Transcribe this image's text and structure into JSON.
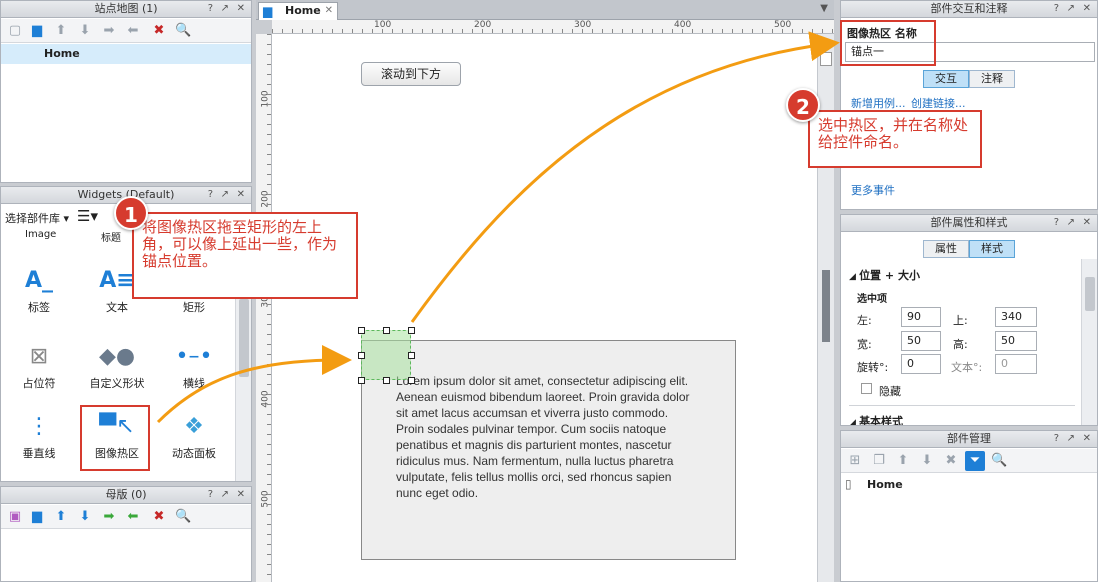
{
  "sitemap": {
    "title": "站点地图 (1)",
    "controls": [
      "?",
      "↗",
      "✕"
    ],
    "pages": [
      "Home"
    ]
  },
  "widgets": {
    "title": "Widgets (Default)",
    "library_label": "选择部件库 ▾",
    "partial_top": [
      "Image",
      "标题"
    ],
    "items": [
      {
        "label": "标签",
        "icon": "label-icon"
      },
      {
        "label": "文本",
        "icon": "text-icon"
      },
      {
        "label": "矩形",
        "icon": "rectangle-icon"
      },
      {
        "label": "占位符",
        "icon": "placeholder-icon"
      },
      {
        "label": "自定义形状",
        "icon": "custom-shape-icon"
      },
      {
        "label": "横线",
        "icon": "horizontal-line-icon"
      },
      {
        "label": "垂直线",
        "icon": "vertical-line-icon"
      },
      {
        "label": "图像热区",
        "icon": "image-hotspot-icon"
      },
      {
        "label": "动态面板",
        "icon": "dynamic-panel-icon"
      }
    ]
  },
  "masters": {
    "title": "母版 (0)"
  },
  "canvas": {
    "tab_label": "Home",
    "ruler_h": [
      "100",
      "200",
      "300",
      "400",
      "500"
    ],
    "ruler_v": [
      "100",
      "200",
      "300",
      "400",
      "500"
    ],
    "button_label": "滚动到下方",
    "lorem": "Lorem ipsum dolor sit amet, consectetur adipiscing elit. Aenean euismod bibendum laoreet. Proin gravida dolor sit amet lacus accumsan et viverra justo commodo. Proin sodales pulvinar tempor. Cum sociis natoque penatibus et magnis dis parturient montes, nascetur ridiculus mus. Nam fermentum, nulla luctus pharetra vulputate, felis tellus mollis orci, sed rhoncus sapien nunc eget odio."
  },
  "interaction": {
    "title": "部件交互和注释",
    "name_label": "图像热区 名称",
    "name_value": "锚点一",
    "tab_interact": "交互",
    "tab_notes": "注释",
    "link_new_case": "新增用例...",
    "link_create_link": "创建链接...",
    "more_events": "更多事件"
  },
  "props": {
    "title": "部件属性和样式",
    "tab_props": "属性",
    "tab_style": "样式",
    "section_pos": "位置 + 大小",
    "selected_label": "选中项",
    "left_label": "左:",
    "left_value": "90",
    "top_label": "上:",
    "top_value": "340",
    "width_label": "宽:",
    "width_value": "50",
    "height_label": "高:",
    "height_value": "50",
    "rotate_label": "旋转°:",
    "rotate_value": "0",
    "text_rot_label": "文本°:",
    "text_rot_value": "0",
    "hide_label": "隐藏",
    "section_basic": "基本样式"
  },
  "manager": {
    "title": "部件管理",
    "items": [
      "Home"
    ]
  },
  "callouts": {
    "one_num": "1",
    "one_text": "将图像热区拖至矩形的左上角，可以像上延出一些，作为锚点位置。",
    "two_num": "2",
    "two_text": "选中热区，并在名称处给控件命名。"
  }
}
